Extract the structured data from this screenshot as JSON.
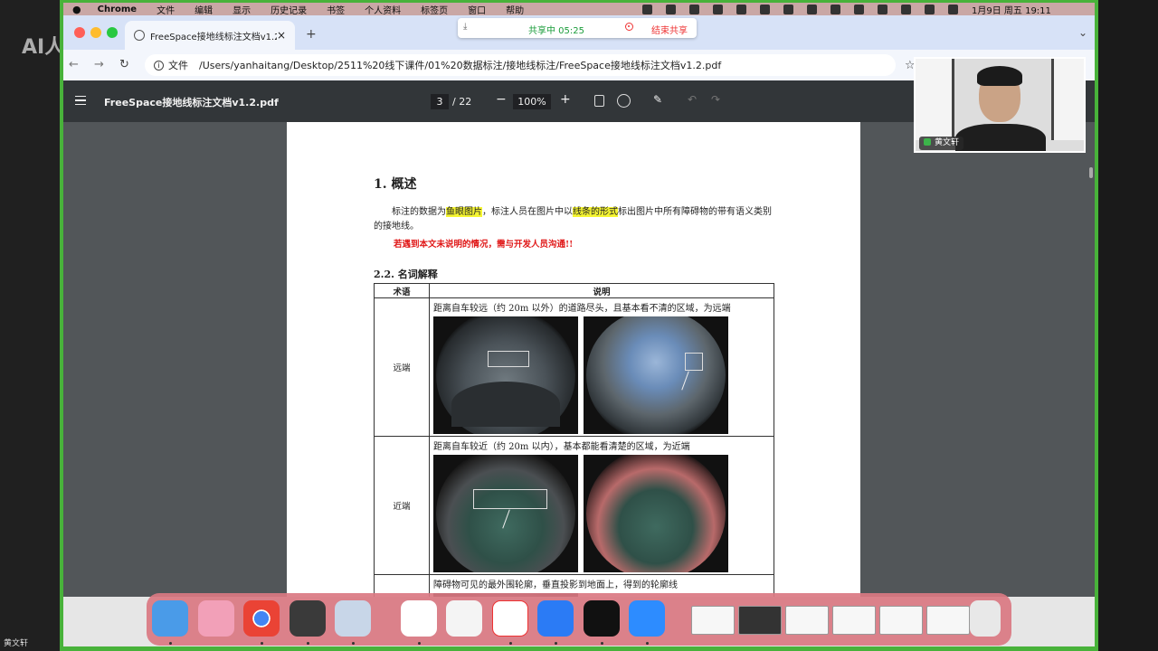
{
  "watermark": "AI人工智能",
  "bottom_name": "黄文轩",
  "menubar": {
    "app": "Chrome",
    "items": [
      "文件",
      "编辑",
      "显示",
      "历史记录",
      "书签",
      "个人资料",
      "标签页",
      "窗口",
      "帮助"
    ],
    "datetime": "1月9日 周五 19:11"
  },
  "tab": {
    "title": "FreeSpace接地线标注文档v1.2.pdf"
  },
  "share_banner": {
    "status": "共享中 05:25",
    "stop": "结束共享"
  },
  "address": {
    "file_label": "文件",
    "url": "/Users/yanhaitang/Desktop/2511%20线下课件/01%20数据标注/接地线标注/FreeSpace接地线标注文档v1.2.pdf"
  },
  "pdf": {
    "title": "FreeSpace接地线标注文档v1.2.pdf",
    "current_page": "3",
    "total_pages": "/ 22",
    "zoom": "100%"
  },
  "doc": {
    "heading": "1.  概述",
    "para_1": "标注的数据为",
    "para_hl1": "鱼眼图片",
    "para_2": "，标注人员在图片中以",
    "para_hl2": "线条的形式",
    "para_3": "标出图片中所有障碍物的带有语义类别的接地线。",
    "warning": "若遇到本文未说明的情况，需与开发人员沟通!!",
    "section": "2.2.  名词解释",
    "table": {
      "col_term": "术语",
      "col_desc": "说明",
      "rows": [
        {
          "term": "远端",
          "desc": "距离自车较远（约 20m 以外）的道路尽头，且基本看不清的区域，为远端"
        },
        {
          "term": "近端",
          "desc": "距离自车较近（约 20m 以内），基本都能看清楚的区域，为近端"
        },
        {
          "term": "",
          "desc": "障碍物可见的最外围轮廓，垂直投影到地面上，得到的轮廓线"
        }
      ]
    }
  },
  "webcam": {
    "name": "黄文轩"
  },
  "colors": {
    "frame": "#48b23a",
    "pdf_toolbar": "#323639",
    "viewer_bg": "#525659",
    "dock": "#da7882",
    "highlight": "#f5f531",
    "warning": "#e01818"
  }
}
